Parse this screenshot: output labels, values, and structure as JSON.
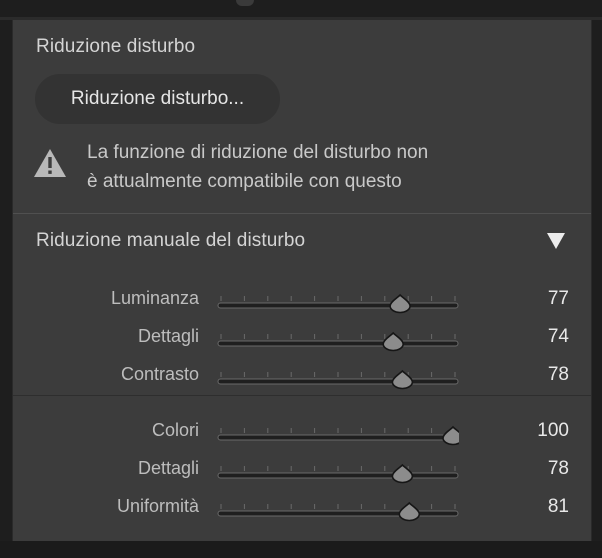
{
  "noise_reduction": {
    "title": "Riduzione disturbo",
    "button_label": "Riduzione disturbo...",
    "warning_line1": "La funzione di riduzione del disturbo non",
    "warning_line2": "è attualmente compatibile con questo"
  },
  "manual": {
    "title": "Riduzione manuale del disturbo",
    "collapse_icon": "triangle-down-icon",
    "luminance_group": [
      {
        "label": "Luminanza",
        "value": "77",
        "level": 77
      },
      {
        "label": "Dettagli",
        "value": "74",
        "level": 74
      },
      {
        "label": "Contrasto",
        "value": "78",
        "level": 78
      }
    ],
    "color_group": [
      {
        "label": "Colori",
        "value": "100",
        "level": 100
      },
      {
        "label": "Dettagli",
        "value": "78",
        "level": 78
      },
      {
        "label": "Uniformità",
        "value": "81",
        "level": 81
      }
    ]
  },
  "colors": {
    "panel": "#3c3c3c",
    "text": "#d4d4d4",
    "value_text": "#e8e8e8",
    "thumb": "#8a8a8a"
  }
}
